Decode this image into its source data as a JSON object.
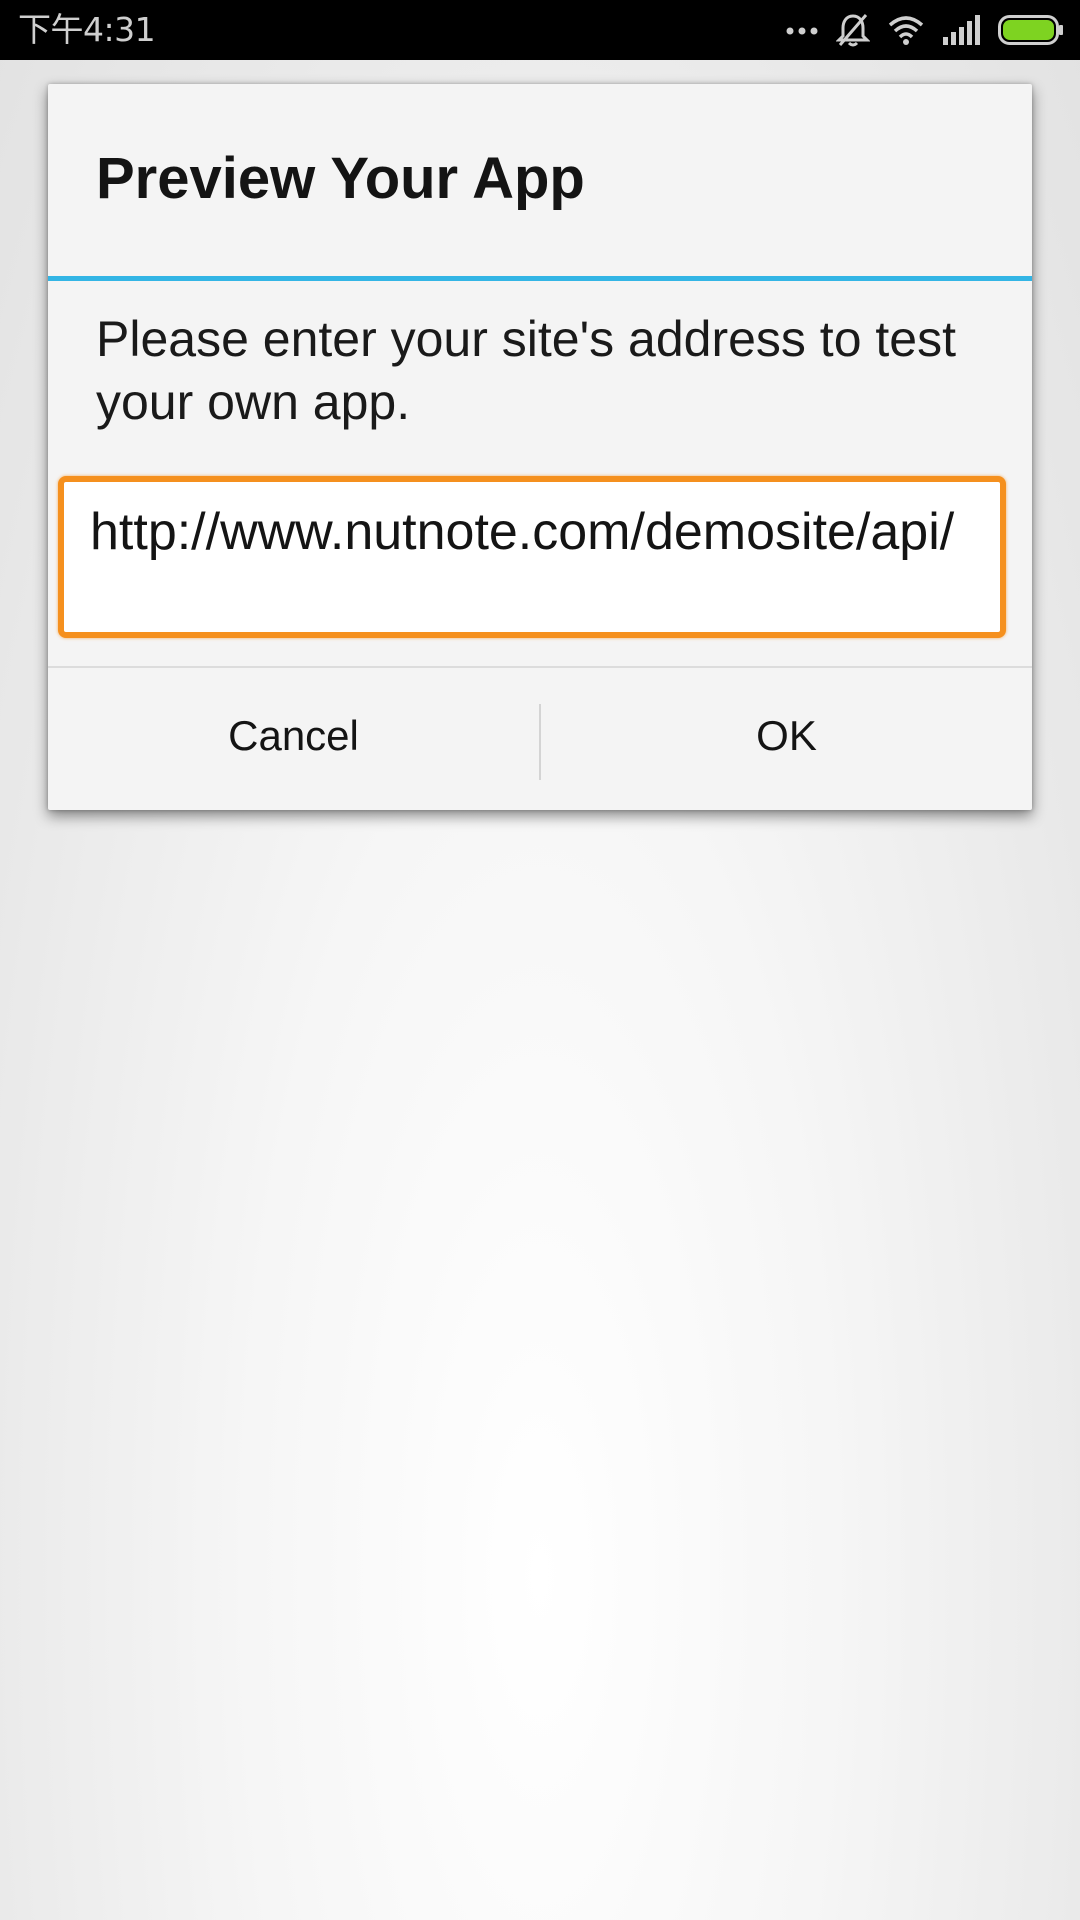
{
  "status_bar": {
    "time": "下午4:31",
    "icons": [
      "more-dots-icon",
      "mute-bell-icon",
      "wifi-icon",
      "signal-icon",
      "battery-icon"
    ],
    "battery_color": "#7ed321"
  },
  "dialog": {
    "title": "Preview Your App",
    "message": "Please enter your site's address to test your own app.",
    "url_field": {
      "value": "http://www.nutnote.com/demosite/api/",
      "focused": true
    },
    "buttons": {
      "cancel_label": "Cancel",
      "ok_label": "OK"
    },
    "accent_color": "#33b5e5",
    "focus_color": "#f5901e"
  }
}
